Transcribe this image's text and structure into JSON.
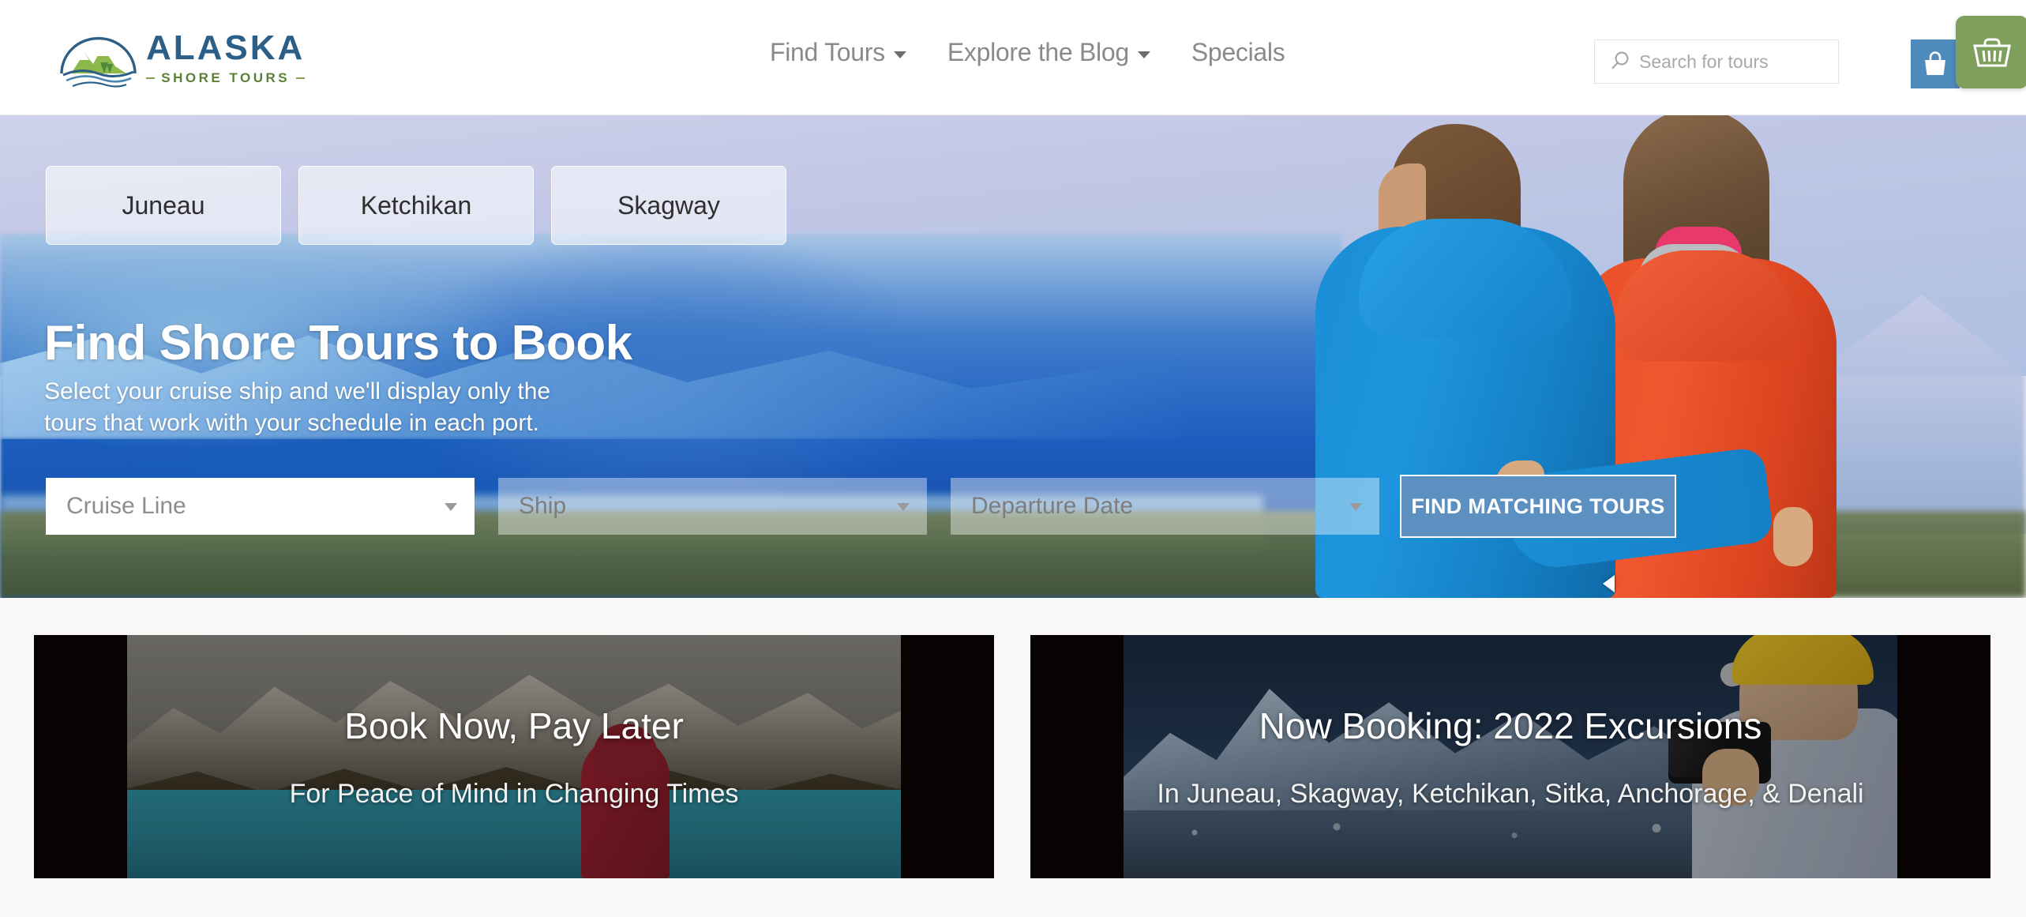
{
  "header": {
    "logo": {
      "brand": "ALASKA",
      "tagline": "SHORE TOURS",
      "mark_icon": "mountain-arc-icon"
    },
    "nav": [
      {
        "label": "Find Tours",
        "has_dropdown": true
      },
      {
        "label": "Explore the Blog",
        "has_dropdown": true
      },
      {
        "label": "Specials",
        "has_dropdown": false
      }
    ],
    "search": {
      "placeholder": "Search for tours",
      "value": "",
      "icon": "search-icon"
    },
    "bag_button": {
      "icon": "shopping-bag-icon",
      "color": "#4f8abd"
    },
    "basket_button": {
      "icon": "shopping-basket-icon",
      "color": "#7fa05c"
    }
  },
  "hero": {
    "port_tabs": [
      {
        "label": "Juneau"
      },
      {
        "label": "Ketchikan"
      },
      {
        "label": "Skagway"
      }
    ],
    "title": "Find Shore Tours to Book",
    "subtitle": "Select your cruise ship and we'll display only the tours that work with your schedule in each port.",
    "form": {
      "cruise_line": {
        "label": "Cruise Line",
        "value": "",
        "enabled": true
      },
      "ship": {
        "label": "Ship",
        "value": "",
        "enabled": false
      },
      "departure_date": {
        "label": "Departure Date",
        "value": "",
        "enabled": false
      },
      "submit_label": "FIND MATCHING TOURS"
    },
    "carousel_prev_icon": "chevron-left-icon"
  },
  "promos": [
    {
      "title": "Book Now, Pay Later",
      "subtitle": "For Peace of Mind in Changing Times"
    },
    {
      "title": "Now Booking: 2022 Excursions",
      "subtitle": "In Juneau, Skagway, Ketchikan, Sitka, Anchorage, & Denali"
    }
  ],
  "colors": {
    "brand_blue": "#2c5f87",
    "brand_green": "#5b8036",
    "accent_blue": "#5b90c0",
    "basket_green": "#7fa05c",
    "page_bg": "#f8f8f8"
  }
}
